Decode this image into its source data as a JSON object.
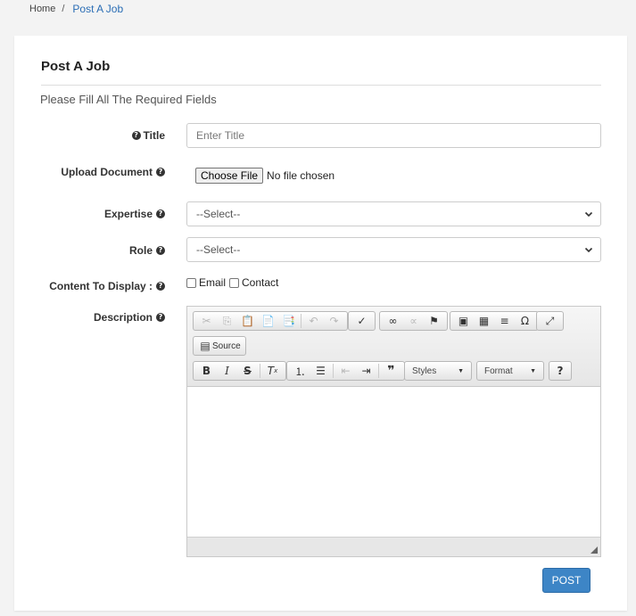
{
  "breadcrumb": {
    "home": "Home",
    "separator": "/",
    "current": "Post A Job"
  },
  "card": {
    "title": "Post A Job",
    "subtitle": "Please Fill All The Required Fields"
  },
  "form": {
    "title": {
      "label": "Title",
      "placeholder": "Enter Title"
    },
    "upload": {
      "label": "Upload Document",
      "button": "Choose File",
      "status": "No file chosen"
    },
    "expertise": {
      "label": "Expertise",
      "value": "--Select--"
    },
    "role": {
      "label": "Role",
      "value": "--Select--"
    },
    "content_display": {
      "label": "Content To Display :",
      "options": [
        "Email",
        "Contact"
      ]
    },
    "description": {
      "label": "Description"
    }
  },
  "editor": {
    "source_label": "Source",
    "styles_label": "Styles",
    "format_label": "Format",
    "help_label": "?"
  },
  "actions": {
    "post_label": "POST"
  },
  "icons": {
    "question": "question-circle-icon",
    "chevron": "chevron-down-icon"
  }
}
